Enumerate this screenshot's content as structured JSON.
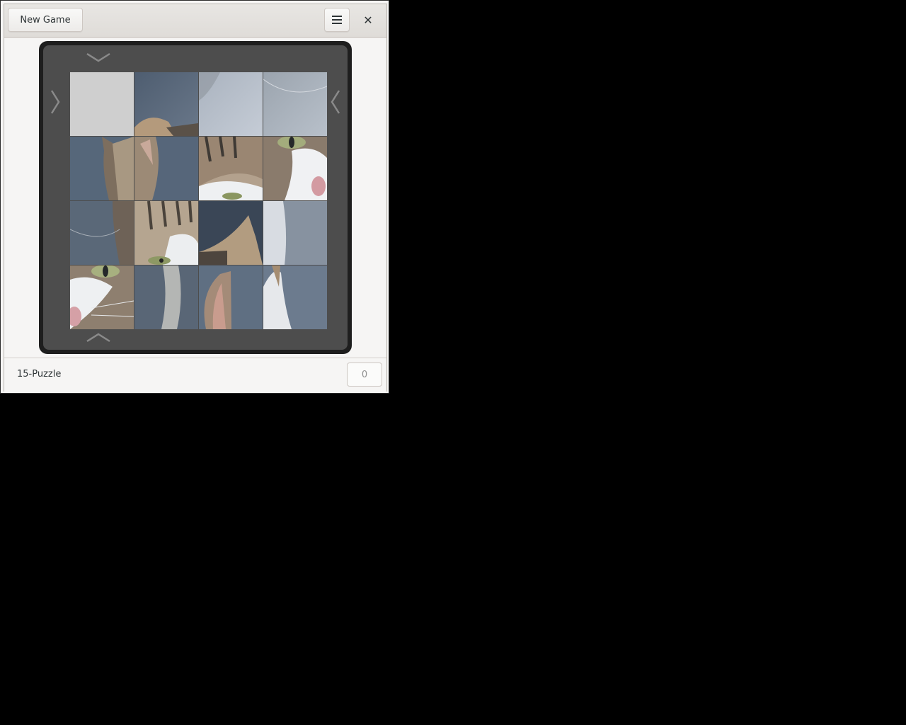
{
  "header": {
    "new_game_label": "New Game",
    "menu_icon": "hamburger-menu-icon",
    "close_icon": "close-icon",
    "close_glyph": "✕"
  },
  "board": {
    "rows": 4,
    "cols": 4,
    "image_subject": "cat",
    "blank_position": [
      0,
      0
    ],
    "arrows": [
      "slide-down-arrow",
      "slide-right-arrow",
      "slide-left-arrow",
      "slide-up-arrow"
    ],
    "colors": {
      "frame": "#1e1e1e",
      "board": "#4d4d4d",
      "blank_tile": "#cfcfcf",
      "arrow": "#8a8a8a"
    }
  },
  "status": {
    "title": "15-Puzzle",
    "moves": "0"
  }
}
